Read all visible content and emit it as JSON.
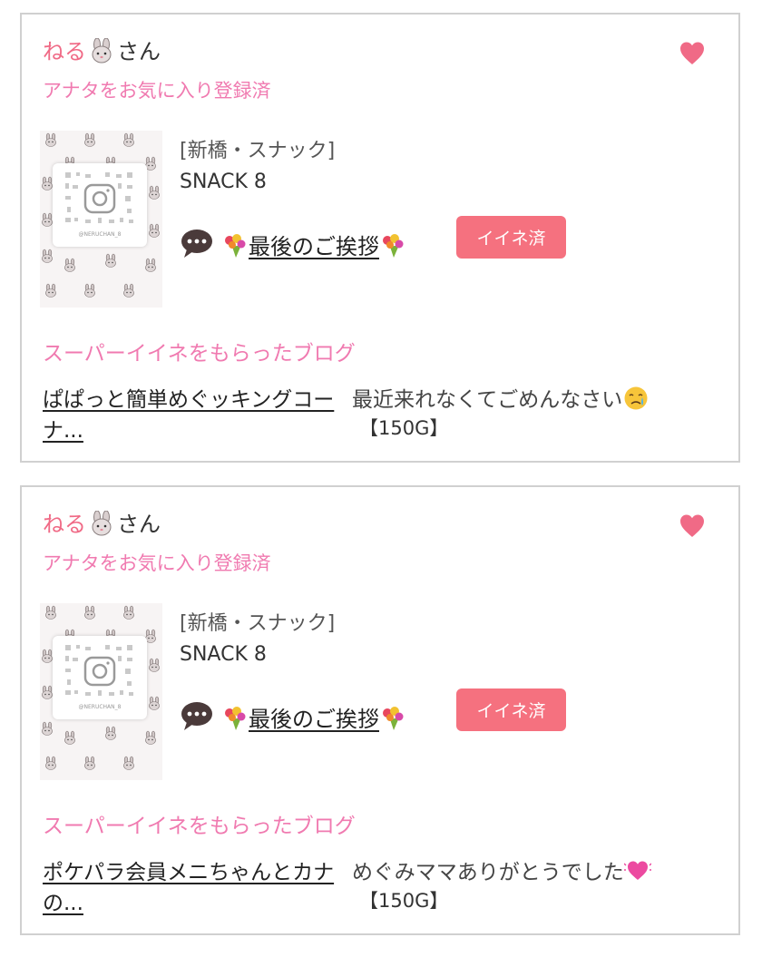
{
  "cards": [
    {
      "user_name": "ねる",
      "user_suffix": "さん",
      "favorite_status": "アナタをお気に入り登録済",
      "category": "[新橋・スナック]",
      "shop_name": "SNACK 8",
      "blog_title": "最後のご挨拶",
      "like_button": "イイネ済",
      "super_like_heading": "スーパーイイネをもらったブログ",
      "super_blog_title": "ぱぱっと簡単めぐッキングコーナ...",
      "comment": "最近来れなくてごめんなさい",
      "comment_emoji": "crying-face-icon",
      "reward": "【150G】"
    },
    {
      "user_name": "ねる",
      "user_suffix": "さん",
      "favorite_status": "アナタをお気に入り登録済",
      "category": "[新橋・スナック]",
      "shop_name": "SNACK 8",
      "blog_title": "最後のご挨拶",
      "like_button": "イイネ済",
      "super_like_heading": "スーパーイイネをもらったブログ",
      "super_blog_title": "ポケパラ会員メニちゃんとカナの...",
      "comment": "めぐみママありがとうでした",
      "comment_emoji": "heart-icon",
      "reward": "【150G】"
    }
  ],
  "thumbnail_handle": "@NERUCHAN_8",
  "colors": {
    "pink": "#f06a86",
    "button": "#f5717f",
    "heading": "#f07ab0"
  }
}
